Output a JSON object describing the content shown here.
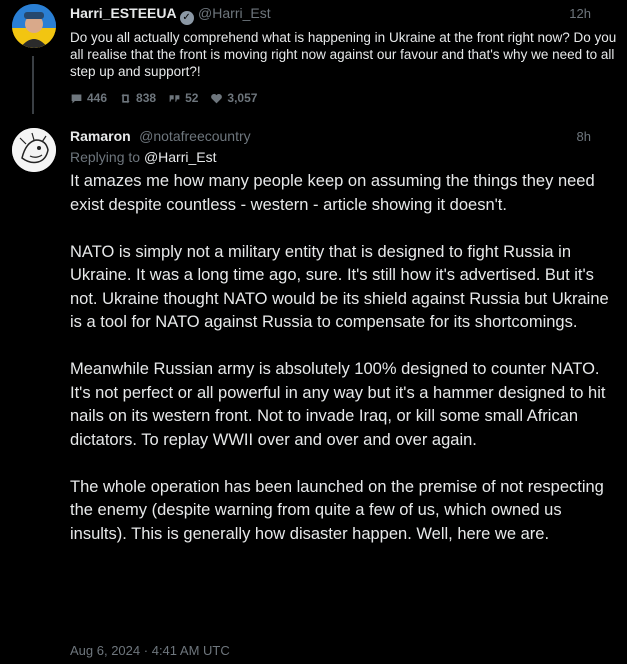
{
  "tweet1": {
    "display_name": "Harri_ESTEEUA",
    "handle": "@Harri_Est",
    "time": "12h",
    "text": "Do you all actually comprehend what is happening in Ukraine at the front right now? Do you all realise that the front is moving right now against our favour and that's why we need to all step up and support?!",
    "stats": {
      "replies": "446",
      "retweets": "838",
      "quotes": "52",
      "likes": "3,057"
    }
  },
  "tweet2": {
    "display_name": "Ramaron",
    "handle": "@notafreecountry",
    "time": "8h",
    "replying_prefix": "Replying to",
    "replying_to": "@Harri_Est",
    "paragraphs": [
      "It amazes me how many people keep on assuming the things they need exist despite countless - western - article showing it doesn't.",
      "NATO is simply not a military entity that is designed to fight Russia in Ukraine. It was a long time ago, sure. It's still how it's advertised. But it's not. Ukraine thought NATO would be its shield against Russia but Ukraine is a tool for NATO against Russia to compensate for its shortcomings.",
      "Meanwhile Russian army is absolutely 100% designed to counter NATO. It's not perfect or all powerful in any way but it's a hammer designed to hit nails on its western front. Not to invade Iraq, or kill some small African dictators. To replay WWII over and over and over again.",
      "The whole operation has been launched on the premise of not respecting the enemy (despite warning from quite a few of us, which owned us insults). This is generally how disaster happen. Well, here we are."
    ],
    "date": "Aug 6, 2024",
    "separator": "·",
    "clock": "4:41 AM UTC"
  },
  "icons": {
    "verified": "verified-badge-icon",
    "reply": "reply-icon",
    "retweet": "retweet-icon",
    "quote": "quote-icon",
    "like": "heart-icon"
  },
  "colors": {
    "background": "#000000",
    "text": "#e7e9ea",
    "muted": "#6e767d"
  }
}
